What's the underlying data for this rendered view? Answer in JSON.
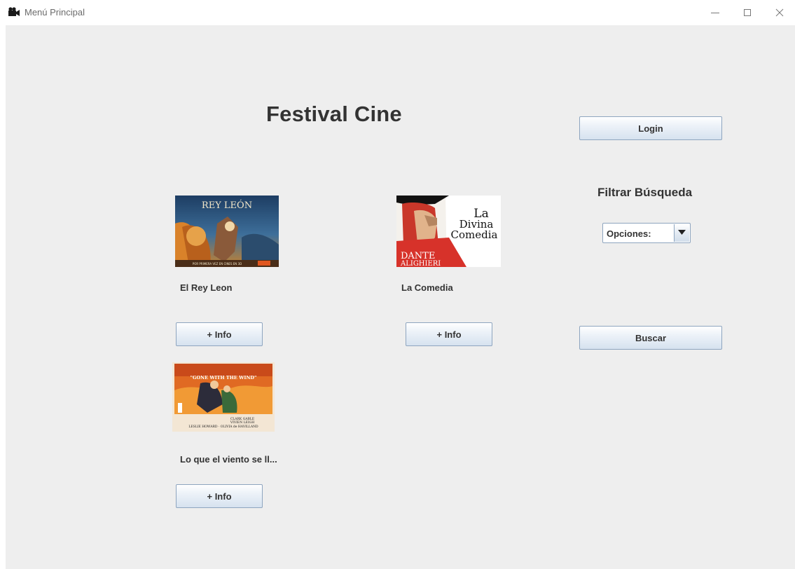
{
  "window": {
    "title": "Menú Principal",
    "icon": "film-camera-icon",
    "controls": [
      "minimize-icon",
      "maximize-icon",
      "close-icon"
    ]
  },
  "header": {
    "title": "Festival Cine"
  },
  "auth": {
    "login_label": "Login"
  },
  "movies": [
    {
      "title": "El Rey Leon",
      "info_label": "+ Info",
      "poster": {
        "heading": "REY LEÓN",
        "tagline": "POR PRIMERA VEZ EN CINES EN 3D"
      }
    },
    {
      "title": "La Comedia",
      "info_label": "+ Info",
      "poster": {
        "line1": "La",
        "line2": "Divina",
        "line3": "Comedia",
        "author1": "DANTE",
        "author2": "ALIGHIERI"
      }
    },
    {
      "title": "Lo que el viento se ll...",
      "info_label": "+ Info",
      "poster": {
        "heading": "\"GONE WITH THE WIND\"",
        "cast1": "CLARK GABLE",
        "cast2": "VIVIEN LEIGH",
        "cast3": "LESLIE HOWARD · OLIVIA de HAVILLAND"
      }
    }
  ],
  "filter": {
    "title": "Filtrar Búsqueda",
    "selected": "Opciones:",
    "search_label": "Buscar"
  },
  "colors": {
    "background": "#eeeeee",
    "button_border": "#8ea5bf",
    "text": "#333333"
  }
}
